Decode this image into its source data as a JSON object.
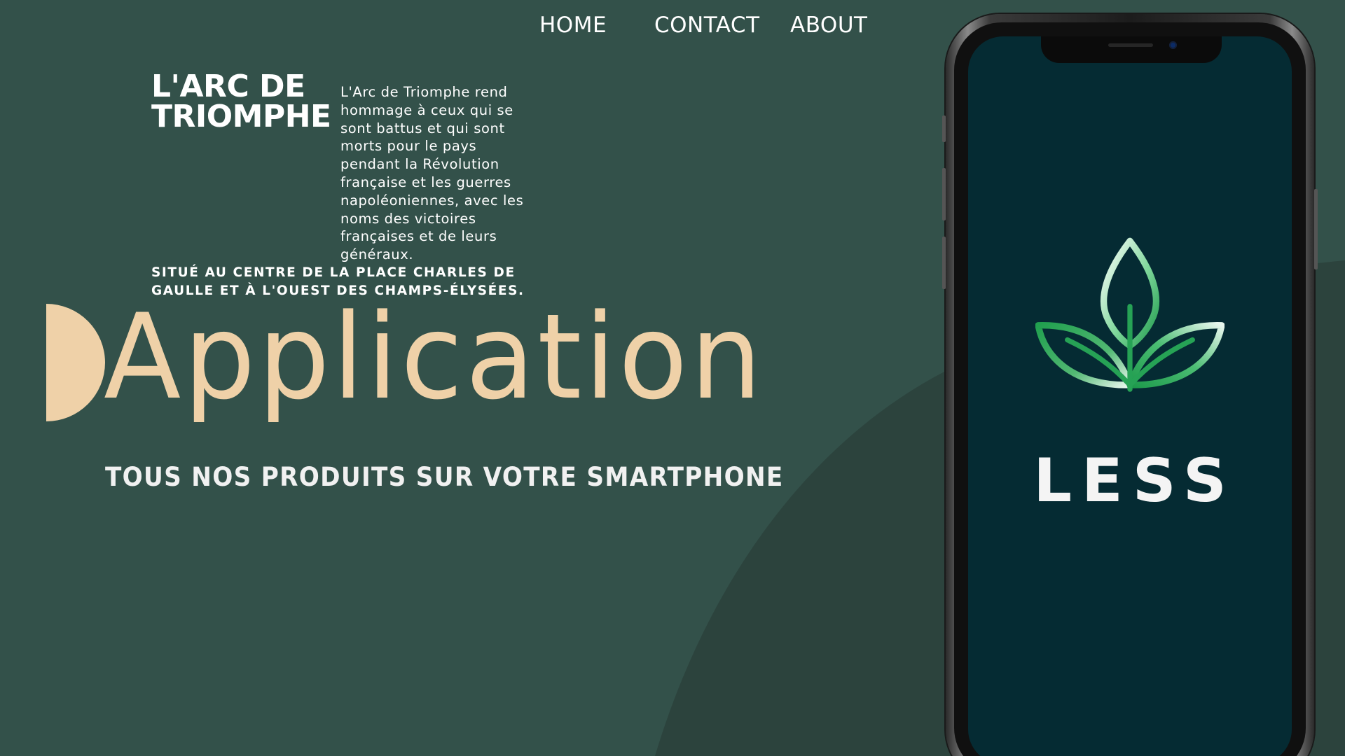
{
  "nav": {
    "items": [
      "HOME",
      "CONTACT",
      "ABOUT"
    ]
  },
  "hero": {
    "title": "L'ARC DE TRIOMPHE",
    "description": "L'Arc de Triomphe rend hommage à ceux qui se sont battus et qui sont morts pour le pays pendant la Révolution française et les guerres napoléoniennes, avec les noms des victoires françaises et de leurs généraux.",
    "location": "SITUÉ AU CENTRE DE LA PLACE CHARLES DE GAULLE ET À L'OUEST DES CHAMPS-ÉLYSÉES."
  },
  "banner": {
    "word": "Application",
    "tagline": "TOUS NOS PRODUITS SUR VOTRE SMARTPHONE"
  },
  "phone": {
    "brand_name": "LESS",
    "logo_icon": "leaf-logo-icon"
  },
  "colors": {
    "background": "#33514a",
    "background_curve": "#2c433d",
    "accent": "#efd1a8",
    "screen": "#052b33",
    "logo_green": "#2aa55a"
  }
}
